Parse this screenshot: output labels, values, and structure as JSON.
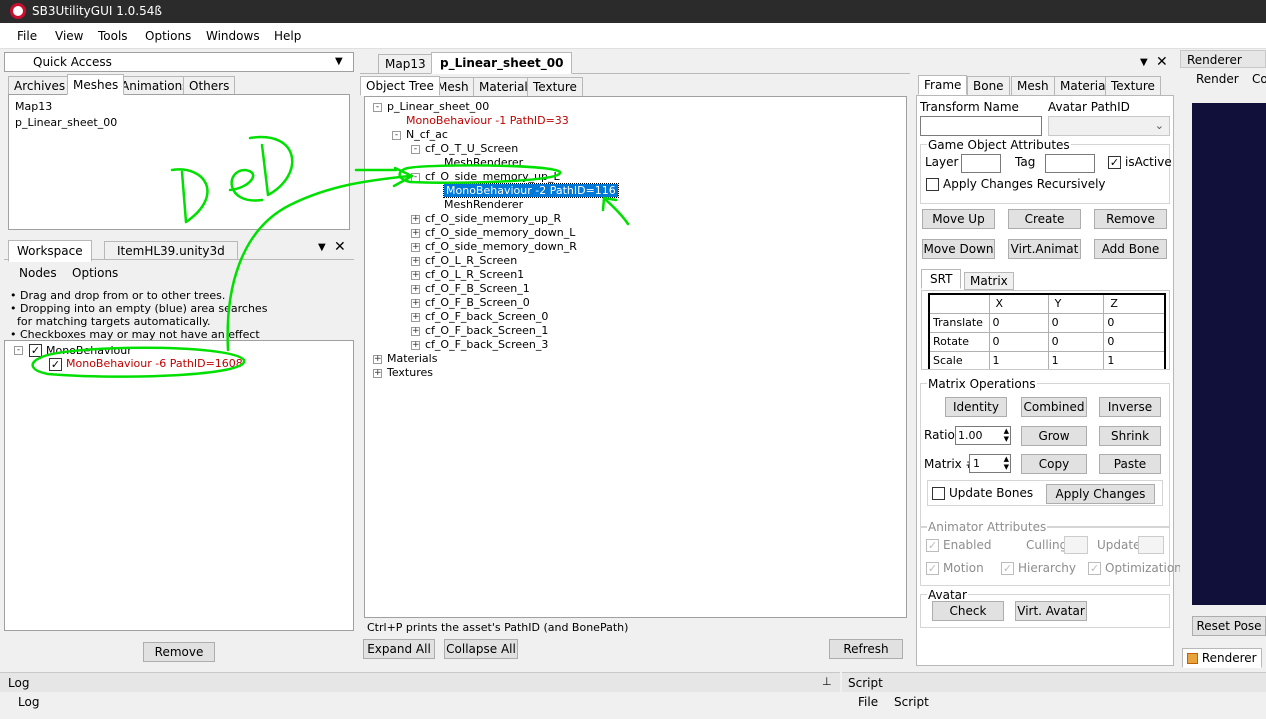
{
  "window": {
    "title": "SB3UtilityGUI 1.0.54ß"
  },
  "menu": [
    "File",
    "View",
    "Tools",
    "Options",
    "Windows",
    "Help"
  ],
  "quick_access": {
    "title": "Quick Access",
    "tabs": [
      "Archives",
      "Meshes",
      "Animations",
      "Others"
    ],
    "items": [
      "Map13",
      "p_Linear_sheet_00"
    ]
  },
  "workspace": {
    "tabs": [
      "Workspace",
      "ItemHL39.unity3d"
    ],
    "menu": [
      "Nodes",
      "Options"
    ],
    "notes": [
      "• Drag and drop from or to other trees.",
      "• Dropping into an empty (blue) area searches",
      "  for matching targets automatically.",
      "• Checkboxes may or may not have an effect"
    ],
    "tree": {
      "root": "MonoBehaviour",
      "child": "MonoBehaviour -6 PathID=1608"
    },
    "remove_label": "Remove"
  },
  "editor": {
    "doc_tabs": [
      "Map13",
      "p_Linear_sheet_00"
    ],
    "inner_tabs": [
      "Object Tree",
      "Mesh",
      "Material",
      "Texture"
    ],
    "tree": [
      {
        "text": "p_Linear_sheet_00",
        "red": false,
        "sel": false,
        "exp": "-"
      },
      {
        "text": "MonoBehaviour -1 PathID=33",
        "red": true,
        "sel": false,
        "exp": ""
      },
      {
        "text": "N_cf_ac",
        "red": false,
        "sel": false,
        "exp": "-"
      },
      {
        "text": "cf_O_T_U_Screen",
        "red": false,
        "sel": false,
        "exp": "-"
      },
      {
        "text": "MeshRenderer",
        "red": false,
        "sel": false,
        "exp": ""
      },
      {
        "text": "cf_O_side_memory_up_L",
        "red": false,
        "sel": false,
        "exp": "-"
      },
      {
        "text": "MonoBehaviour -2 PathID=116",
        "red": false,
        "sel": true,
        "exp": ""
      },
      {
        "text": "MeshRenderer",
        "red": false,
        "sel": false,
        "exp": ""
      },
      {
        "text": "cf_O_side_memory_up_R",
        "red": false,
        "sel": false,
        "exp": "+"
      },
      {
        "text": "cf_O_side_memory_down_L",
        "red": false,
        "sel": false,
        "exp": "+"
      },
      {
        "text": "cf_O_side_memory_down_R",
        "red": false,
        "sel": false,
        "exp": "+"
      },
      {
        "text": "cf_O_L_R_Screen",
        "red": false,
        "sel": false,
        "exp": "+"
      },
      {
        "text": "cf_O_L_R_Screen1",
        "red": false,
        "sel": false,
        "exp": "+"
      },
      {
        "text": "cf_O_F_B_Screen_1",
        "red": false,
        "sel": false,
        "exp": "+"
      },
      {
        "text": "cf_O_F_B_Screen_0",
        "red": false,
        "sel": false,
        "exp": "+"
      },
      {
        "text": "cf_O_F_back_Screen_0",
        "red": false,
        "sel": false,
        "exp": "+"
      },
      {
        "text": "cf_O_F_back_Screen_1",
        "red": false,
        "sel": false,
        "exp": "+"
      },
      {
        "text": "cf_O_F_back_Screen_3",
        "red": false,
        "sel": false,
        "exp": "+"
      },
      {
        "text": "Materials",
        "red": false,
        "sel": false,
        "exp": "+"
      },
      {
        "text": "Textures",
        "red": false,
        "sel": false,
        "exp": "+"
      }
    ],
    "hint": "Ctrl+P prints the asset's PathID (and BonePath)",
    "expand_all": "Expand All",
    "collapse_all": "Collapse All",
    "refresh": "Refresh"
  },
  "props": {
    "tabs": [
      "Frame",
      "Bone",
      "Mesh",
      "Material",
      "Texture"
    ],
    "transform_name_label": "Transform Name",
    "avatar_pathid_label": "Avatar PathID",
    "transform_name_value": "",
    "game_object_attributes": "Game Object Attributes",
    "layer_label": "Layer",
    "tag_label": "Tag",
    "is_active": "isActive",
    "apply_recursive": "Apply Changes Recursively",
    "buttons_row1": [
      "Move Up",
      "Create",
      "Remove"
    ],
    "buttons_row2": [
      "Move Down",
      "Virt.Animat",
      "Add Bone"
    ],
    "srt_tabs": [
      "SRT",
      "Matrix"
    ],
    "srt_headers": [
      "",
      "X",
      "Y",
      "Z"
    ],
    "srt_rows": [
      {
        "name": "Translate",
        "x": "0",
        "y": "0",
        "z": "0"
      },
      {
        "name": "Rotate",
        "x": "0",
        "y": "0",
        "z": "0"
      },
      {
        "name": "Scale",
        "x": "1",
        "y": "1",
        "z": "1"
      }
    ],
    "matrix_ops": "Matrix Operations",
    "ops_row1": [
      "Identity",
      "Combined",
      "Inverse"
    ],
    "ratio_label": "Ratio",
    "ratio_value": "1.00",
    "grow": "Grow",
    "shrink": "Shrink",
    "matrix_num_label": "Matrix #",
    "matrix_num_value": "1",
    "copy": "Copy",
    "paste": "Paste",
    "update_bones": "Update Bones",
    "apply_changes": "Apply Changes",
    "animator_attrs": "Animator Attributes",
    "enabled": "Enabled",
    "culling": "Culling",
    "update": "Update",
    "motion": "Motion",
    "hierarchy": "Hierarchy",
    "optimization": "Optimization",
    "avatar": "Avatar",
    "check": "Check",
    "virt_avatar": "Virt. Avatar"
  },
  "renderer": {
    "title": "Renderer",
    "menu": [
      "Render",
      "Co"
    ],
    "reset_pose": "Reset Pose",
    "bottom_tab": "Renderer",
    "view_color": "#10103a"
  },
  "log": {
    "title": "Log",
    "menu": "Log"
  },
  "script": {
    "title": "Script",
    "menu": [
      "File",
      "Script"
    ]
  },
  "annotation": {
    "text": "DeD",
    "color": "#00e000"
  }
}
